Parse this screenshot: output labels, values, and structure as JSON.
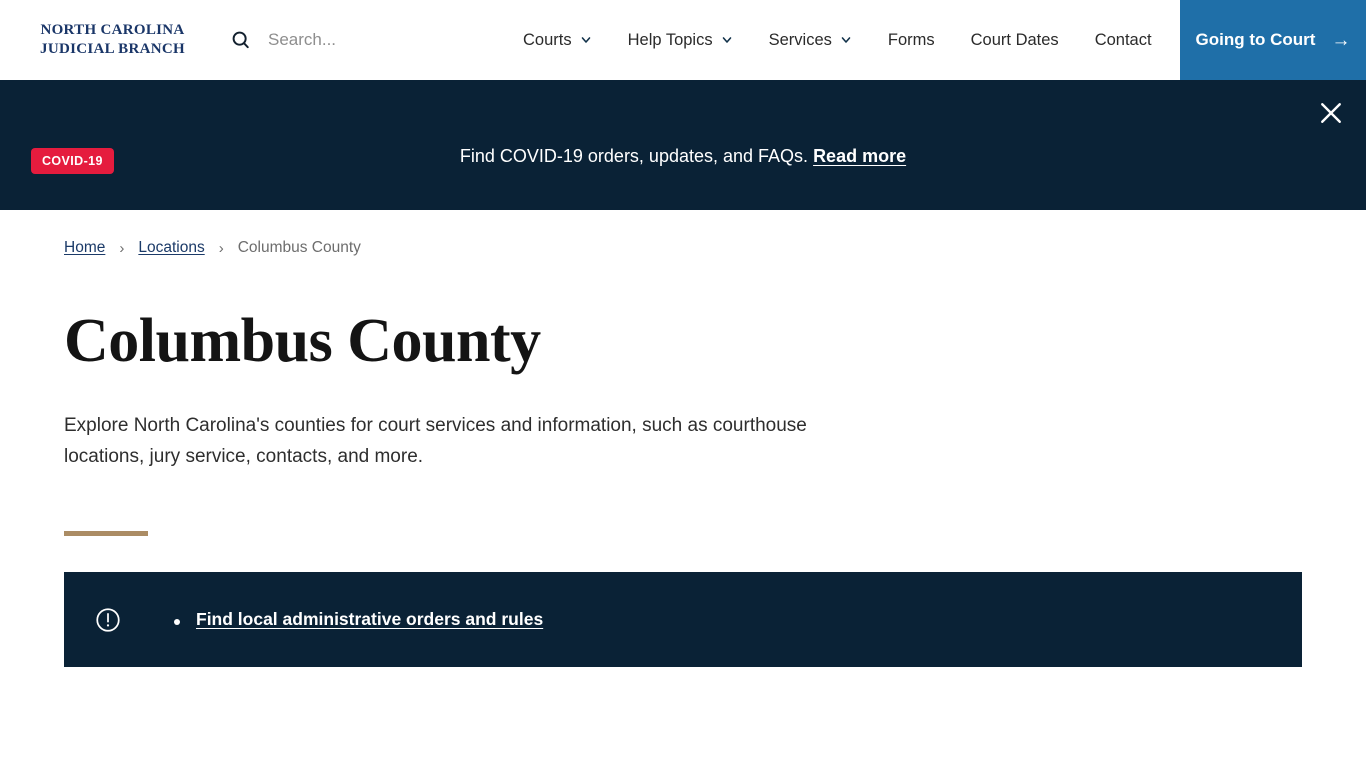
{
  "header": {
    "logo_line1": "NORTH CAROLINA",
    "logo_line2": "JUDICIAL BRANCH",
    "search": {
      "placeholder": "Search...",
      "value": "",
      "icon": "search-icon"
    },
    "nav": [
      {
        "label": "Courts",
        "has_dropdown": true
      },
      {
        "label": "Help Topics",
        "has_dropdown": true
      },
      {
        "label": "Services",
        "has_dropdown": true
      },
      {
        "label": "Forms",
        "has_dropdown": false
      },
      {
        "label": "Court Dates",
        "has_dropdown": false
      },
      {
        "label": "Contact",
        "has_dropdown": false
      }
    ],
    "cta": {
      "label": "Going to Court",
      "arrow": "→",
      "bg": "#1f6fa8"
    }
  },
  "banner": {
    "badge": "COVID-19",
    "badge_color": "#e51c3e",
    "background": "#0a2236",
    "message": "Find COVID-19 orders, updates, and FAQs.",
    "link_label": "Read more",
    "close_icon": "close-icon"
  },
  "breadcrumb": {
    "items": [
      {
        "label": "Home",
        "is_link": true
      },
      {
        "label": "Locations",
        "is_link": true
      },
      {
        "label": "Columbus County",
        "is_link": false
      }
    ],
    "separator": "›"
  },
  "page": {
    "title": "Columbus County",
    "lede": "Explore North Carolina's counties for court services and information, such as courthouse locations, jury service, contacts, and more.",
    "rule_color": "#ab8c64"
  },
  "alert": {
    "icon": "exclamation-circle-icon",
    "background": "#0a2236",
    "links": [
      {
        "label": "Find local administrative orders and rules"
      }
    ]
  }
}
